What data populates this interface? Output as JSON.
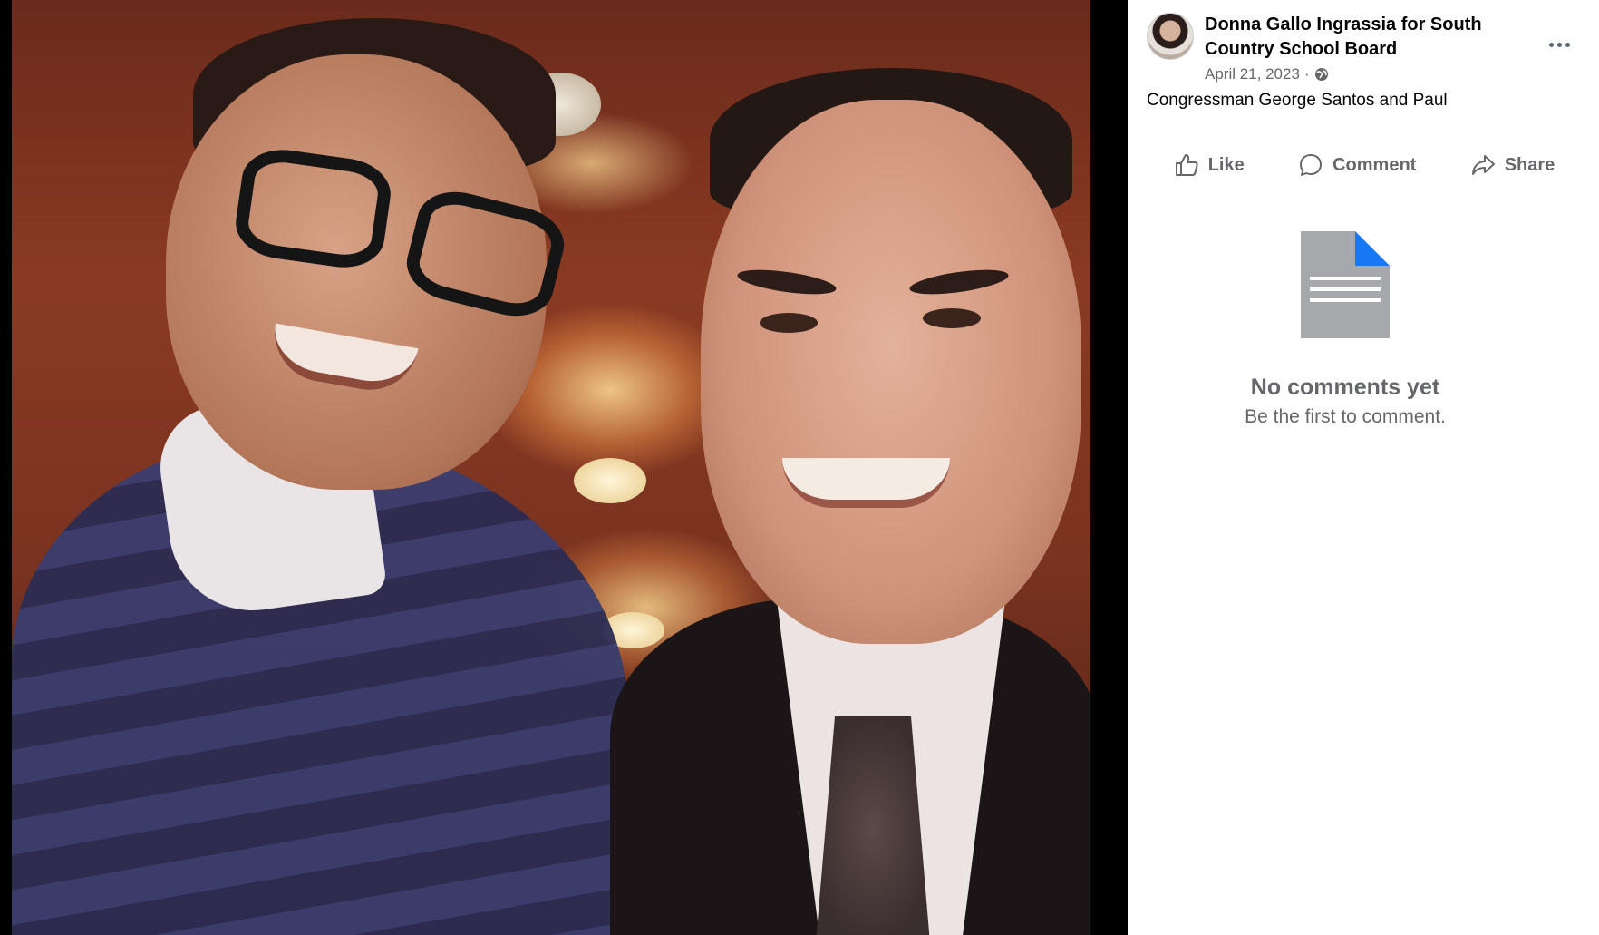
{
  "post": {
    "page_name": "Donna Gallo Ingrassia for South Country School Board",
    "date": "April 21, 2023",
    "separator": "·",
    "audience_icon": "globe-icon",
    "caption": "Congressman George Santos and Paul"
  },
  "actions": {
    "like_label": "Like",
    "comment_label": "Comment",
    "share_label": "Share"
  },
  "comments": {
    "empty_title": "No comments yet",
    "empty_subtitle": "Be the first to comment."
  },
  "colors": {
    "secondary_text": "#65676b",
    "doc_fold_accent": "#1877f2"
  }
}
